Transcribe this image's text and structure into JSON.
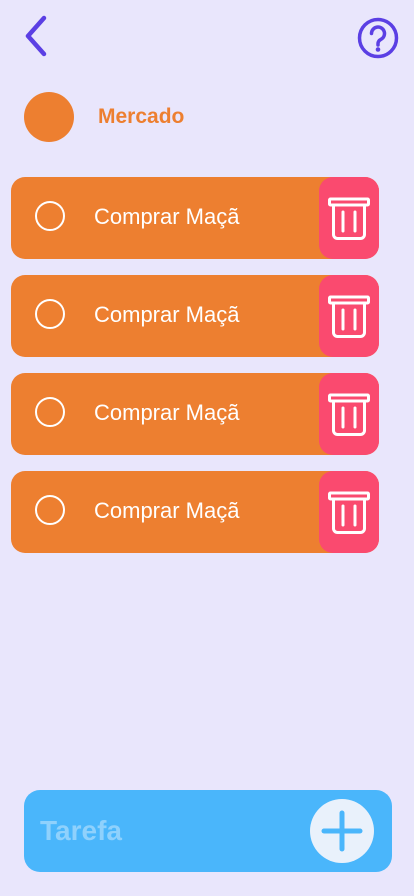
{
  "header": {
    "back_icon": "chevron-left-icon",
    "help_icon": "question-circle-icon"
  },
  "category": {
    "name": "Mercado",
    "color": "#ED7F30"
  },
  "tasks": [
    {
      "label": "Comprar Maçã",
      "done": false
    },
    {
      "label": "Comprar Maçã",
      "done": false
    },
    {
      "label": "Comprar Maçã",
      "done": false
    },
    {
      "label": "Comprar Maçã",
      "done": false
    }
  ],
  "add_bar": {
    "placeholder": "Tarefa",
    "value": "",
    "add_icon": "plus-icon"
  },
  "colors": {
    "background": "#E9E6FC",
    "accent": "#5B3FE4",
    "task": "#ED7F30",
    "delete": "#FA4A6F",
    "add_bar": "#4AB6FB"
  }
}
